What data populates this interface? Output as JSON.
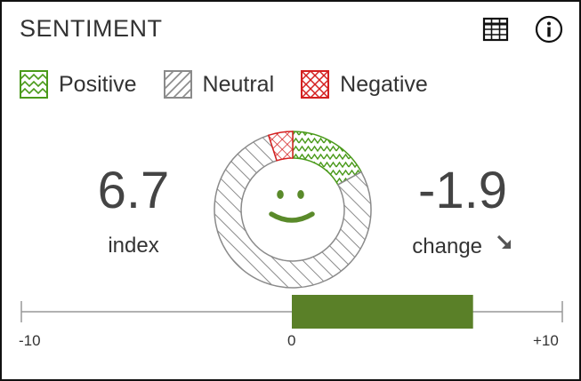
{
  "widget": {
    "title": "SENTIMENT",
    "table_icon": "table-icon",
    "info_icon": "info-icon"
  },
  "legend": [
    {
      "label": "Positive",
      "color": "#4a9a1a",
      "pattern": "zigzag"
    },
    {
      "label": "Neutral",
      "color": "#8a8a8a",
      "pattern": "diagonal"
    },
    {
      "label": "Negative",
      "color": "#d42020",
      "pattern": "crosshatch"
    }
  ],
  "index": {
    "value": "6.7",
    "label": "index"
  },
  "change": {
    "value": "-1.9",
    "label": "change",
    "arrow_icon": "arrow-down-right-icon"
  },
  "donut": {
    "shares": {
      "positive": 0.17,
      "neutral": 0.78,
      "negative": 0.05
    },
    "face_icon": "smiley-face-icon",
    "face_color": "#5a8a2a"
  },
  "scale": {
    "min_label": "-10",
    "zero_label": "0",
    "max_label": "+10",
    "min": -10,
    "max": 10,
    "bar_value": 6.7,
    "bar_color": "#5a8028"
  }
}
